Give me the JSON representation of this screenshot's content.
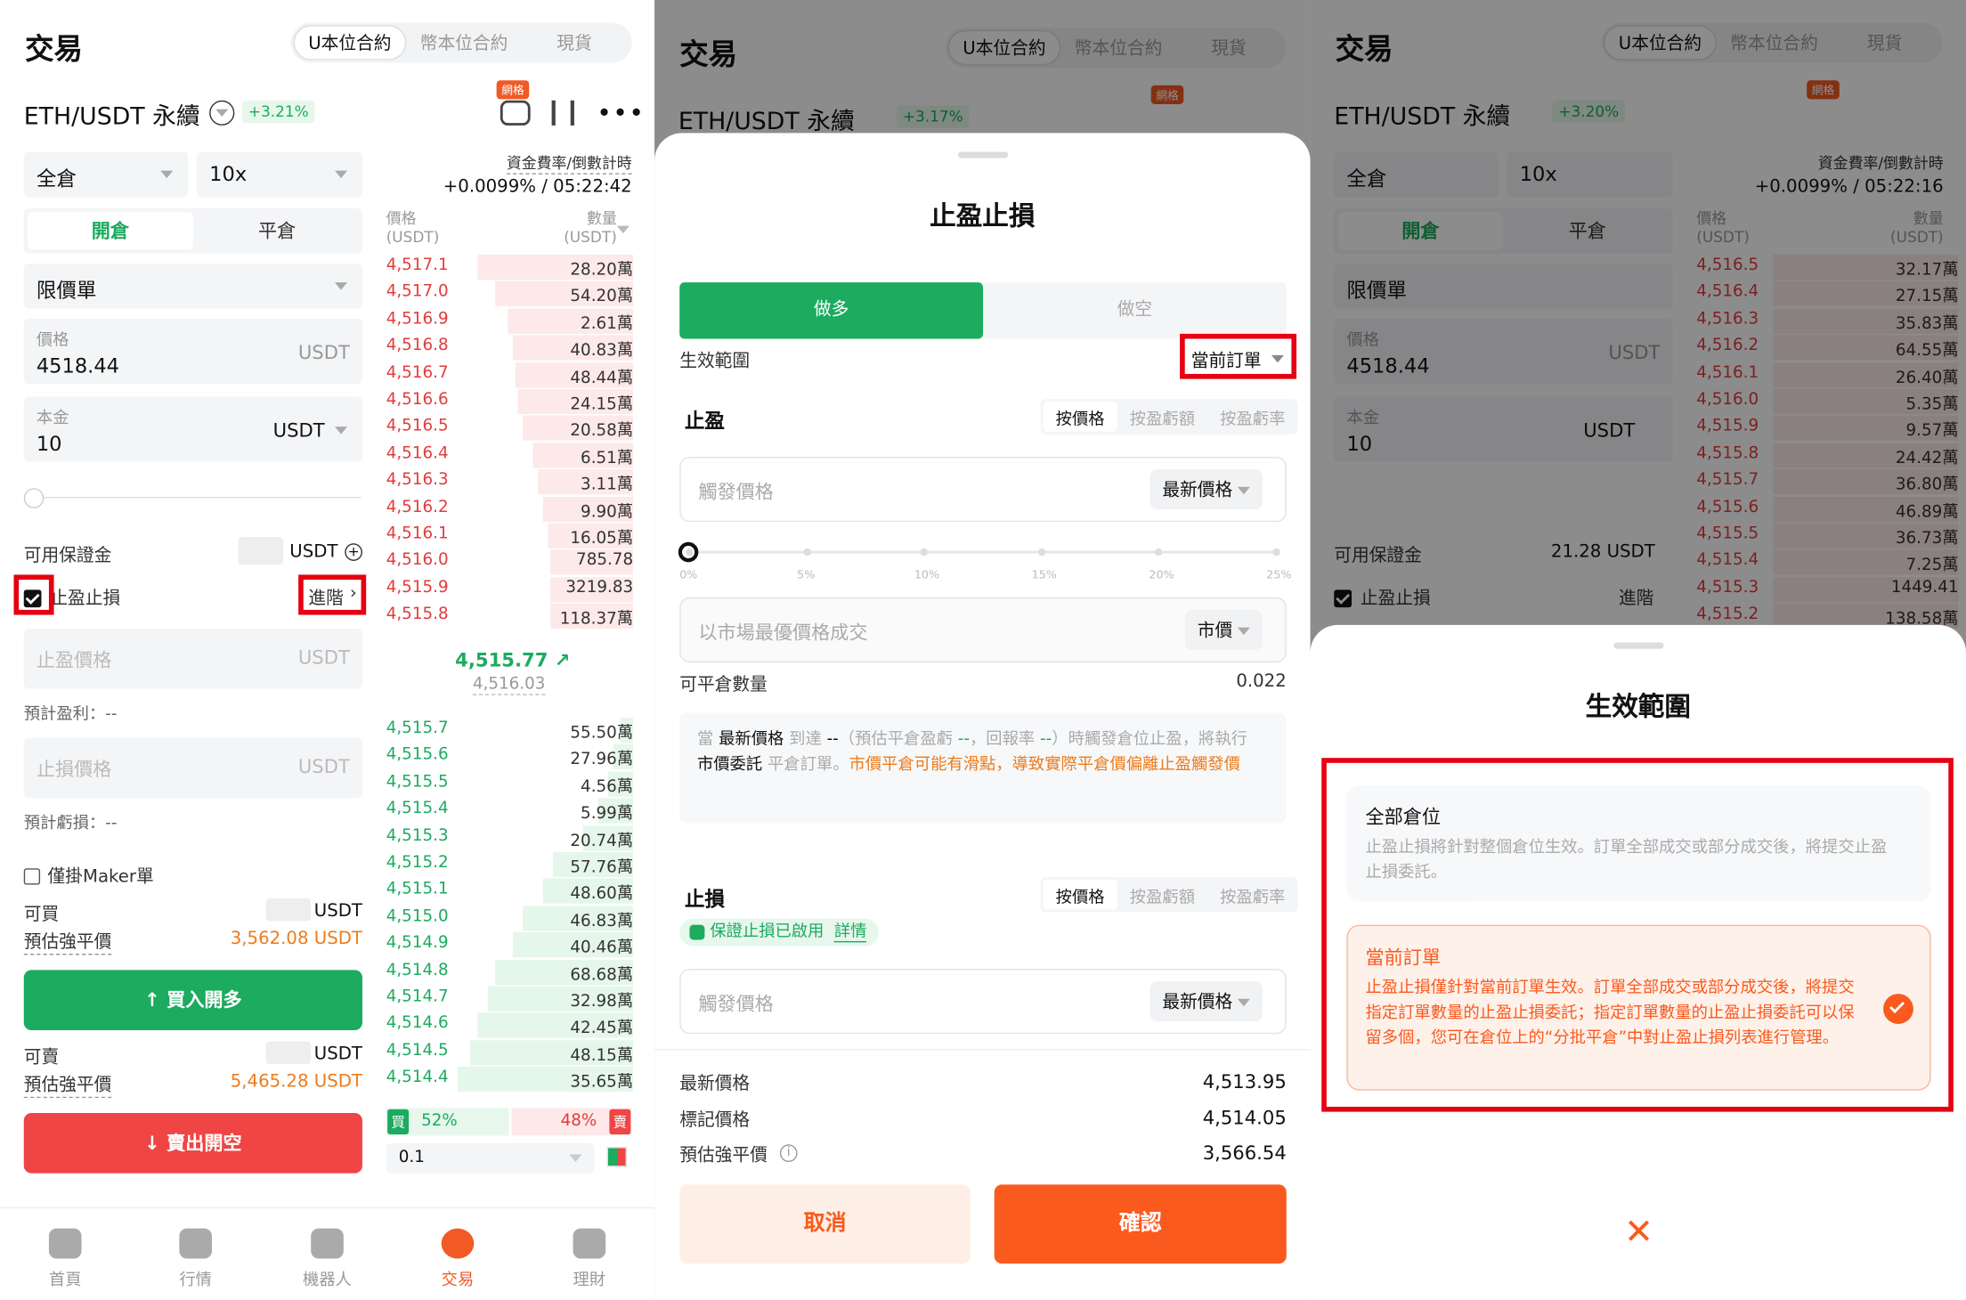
{
  "trade": {
    "title": "交易",
    "tabs": [
      "U本位合約",
      "幣本位合約",
      "現貨"
    ],
    "pair": "ETH/USDT 永續",
    "change": "+3.21%",
    "grid_badge": "網格",
    "funding_label": "資金費率/倒數計時",
    "funding_value": "+0.0099% / 05:22:42",
    "margin_mode": "全倉",
    "leverage": "10x",
    "open_tab": "開倉",
    "close_tab": "平倉",
    "order_type": "限價單",
    "price_label": "價格",
    "price_value": "4518.44",
    "price_unit": "USDT",
    "principal_label": "本金",
    "principal_value": "10",
    "principal_unit": "USDT",
    "available_label": "可用保證金",
    "available_unit": "USDT",
    "tpsl_label": "止盈止損",
    "advanced": "進階",
    "tp_price_ph": "止盈價格",
    "tp_unit": "USDT",
    "expected_profit": "預計盈利：--",
    "sl_price_ph": "止損價格",
    "sl_unit": "USDT",
    "expected_loss": "預計虧損：--",
    "maker_only": "僅掛Maker單",
    "can_buy": "可買",
    "can_buy_unit": "USDT",
    "liq_label": "預估強平價",
    "liq_buy": "3,562.08 USDT",
    "buy_button": "買入開多",
    "can_sell": "可賣",
    "can_sell_unit": "USDT",
    "liq_sell": "5,465.28 USDT",
    "sell_button": "賣出開空",
    "ob_price_head": "價格\n(USDT)",
    "ob_qty_head": "數量\n(USDT)",
    "ob_price_h1": "價格",
    "ob_price_h2": "(USDT)",
    "ob_qty_h1": "數量",
    "ob_qty_h2": "(USDT)",
    "last_price": "4,515.77 ↗",
    "mark_price": "4,516.03",
    "buy_ratio_label": "買",
    "buy_ratio": "52%",
    "sell_ratio": "48%",
    "sell_ratio_label": "賣",
    "depth": "0.1"
  },
  "asks": [
    {
      "p": "4,517.1",
      "q": "28.20萬",
      "w": 0.62
    },
    {
      "p": "4,517.0",
      "q": "54.20萬",
      "w": 0.55
    },
    {
      "p": "4,516.9",
      "q": "2.61萬",
      "w": 0.5
    },
    {
      "p": "4,516.8",
      "q": "40.83萬",
      "w": 0.48
    },
    {
      "p": "4,516.7",
      "q": "48.44萬",
      "w": 0.47
    },
    {
      "p": "4,516.6",
      "q": "24.15萬",
      "w": 0.46
    },
    {
      "p": "4,516.5",
      "q": "20.58萬",
      "w": 0.44
    },
    {
      "p": "4,516.4",
      "q": "6.51萬",
      "w": 0.4
    },
    {
      "p": "4,516.3",
      "q": "3.11萬",
      "w": 0.38
    },
    {
      "p": "4,516.2",
      "q": "9.90萬",
      "w": 0.36
    },
    {
      "p": "4,516.1",
      "q": "16.05萬",
      "w": 0.34
    },
    {
      "p": "4,516.0",
      "q": "785.78",
      "w": 0.33
    },
    {
      "p": "4,515.9",
      "q": "3219.83",
      "w": 0.33
    },
    {
      "p": "4,515.8",
      "q": "118.37萬",
      "w": 0.33
    }
  ],
  "bids": [
    {
      "p": "4,515.7",
      "q": "55.50萬",
      "w": 0.05
    },
    {
      "p": "4,515.6",
      "q": "27.96萬",
      "w": 0.08
    },
    {
      "p": "4,515.5",
      "q": "4.56萬",
      "w": 0.1
    },
    {
      "p": "4,515.4",
      "q": "5.99萬",
      "w": 0.14
    },
    {
      "p": "4,515.3",
      "q": "20.74萬",
      "w": 0.2
    },
    {
      "p": "4,515.2",
      "q": "57.76萬",
      "w": 0.32
    },
    {
      "p": "4,515.1",
      "q": "48.60萬",
      "w": 0.36
    },
    {
      "p": "4,515.0",
      "q": "46.83萬",
      "w": 0.44
    },
    {
      "p": "4,514.9",
      "q": "40.46萬",
      "w": 0.48
    },
    {
      "p": "4,514.8",
      "q": "68.68萬",
      "w": 0.55
    },
    {
      "p": "4,514.7",
      "q": "32.98萬",
      "w": 0.58
    },
    {
      "p": "4,514.6",
      "q": "42.45萬",
      "w": 0.62
    },
    {
      "p": "4,514.5",
      "q": "48.15萬",
      "w": 0.65
    },
    {
      "p": "4,514.4",
      "q": "35.65萬",
      "w": 0.7
    }
  ],
  "nav": [
    "首頁",
    "行情",
    "機器人",
    "交易",
    "理財"
  ],
  "tpsl_sheet": {
    "bg_title": "交易",
    "bg_pair": "ETH/USDT 永續",
    "bg_change": "+3.17%",
    "title": "止盈止損",
    "long": "做多",
    "short": "做空",
    "scope_label": "生效範圍",
    "scope_value": "當前訂單",
    "tp_title": "止盈",
    "mode_tabs": [
      "按價格",
      "按盈虧額",
      "按盈虧率"
    ],
    "trigger_ph": "觸發價格",
    "latest_price_sel": "最新價格",
    "slider_marks": [
      "0%",
      "5%",
      "10%",
      "15%",
      "20%",
      "25%"
    ],
    "market_exec": "以市場最優價格成交",
    "market_sel": "市價",
    "closable_label": "可平倉數量",
    "closable_value": "0.022",
    "note_pre": "當 ",
    "note_b1": "最新價格",
    "note_m1": " 到達 ",
    "note_b2": "--",
    "note_m2": "（預估平倉盈虧 ",
    "note_g1": "--",
    "note_m3": "，回報率 ",
    "note_g2": "--",
    "note_m4": "）時觸發倉位止盈，將執行 ",
    "note_b3": "市價委託",
    "note_m5": " 平倉訂單。",
    "note_o": "市價平倉可能有滑點，導致實際平倉價偏離止盈觸發價",
    "sl_title": "止損",
    "sl_mode_tabs": [
      "按價格",
      "按盈虧額",
      "按盈虧率"
    ],
    "guard_text": "保證止損已啟用",
    "guard_link": "詳情",
    "sl_trigger_ph": "觸發價格",
    "sl_latest_sel": "最新價格",
    "latest_label": "最新價格",
    "latest_value": "4,513.95",
    "mark_label": "標記價格",
    "mark_value": "4,514.05",
    "liq_label": "預估強平價",
    "liq_value": "3,566.54",
    "cancel": "取消",
    "confirm": "確認"
  },
  "scope_sheet": {
    "bg_change": "+3.20%",
    "funding_value": "+0.0099% / 05:22:16",
    "available_value": "21.28 USDT",
    "asks": [
      {
        "p": "4,516.5",
        "q": "32.17萬"
      },
      {
        "p": "4,516.4",
        "q": "27.15萬"
      },
      {
        "p": "4,516.3",
        "q": "35.83萬"
      },
      {
        "p": "4,516.2",
        "q": "64.55萬"
      },
      {
        "p": "4,516.1",
        "q": "26.40萬"
      },
      {
        "p": "4,516.0",
        "q": "5.35萬"
      },
      {
        "p": "4,515.9",
        "q": "9.57萬"
      },
      {
        "p": "4,515.8",
        "q": "24.42萬"
      },
      {
        "p": "4,515.7",
        "q": "36.80萬"
      },
      {
        "p": "4,515.6",
        "q": "46.89萬"
      },
      {
        "p": "4,515.5",
        "q": "36.73萬"
      },
      {
        "p": "4,515.4",
        "q": "7.25萬"
      },
      {
        "p": "4,515.3",
        "q": "1449.41"
      },
      {
        "p": "4,515.2",
        "q": "138.58萬"
      }
    ],
    "title": "生效範圍",
    "opt1_title": "全部倉位",
    "opt1_desc": "止盈止損將針對整個倉位生效。訂單全部成交或部分成交後，將提交止盈止損委託。",
    "opt2_title": "當前訂單",
    "opt2_desc": "止盈止損僅針對當前訂單生效。訂單全部成交或部分成交後，將提交指定訂單數量的止盈止損委託；指定訂單數量的止盈止損委託可以保留多個，您可在倉位上的“分批平倉”中對止盈止損列表進行管理。"
  },
  "colors": {
    "green": "#1cab5f",
    "red": "#e33b3b",
    "accent": "#fa5a1e"
  }
}
